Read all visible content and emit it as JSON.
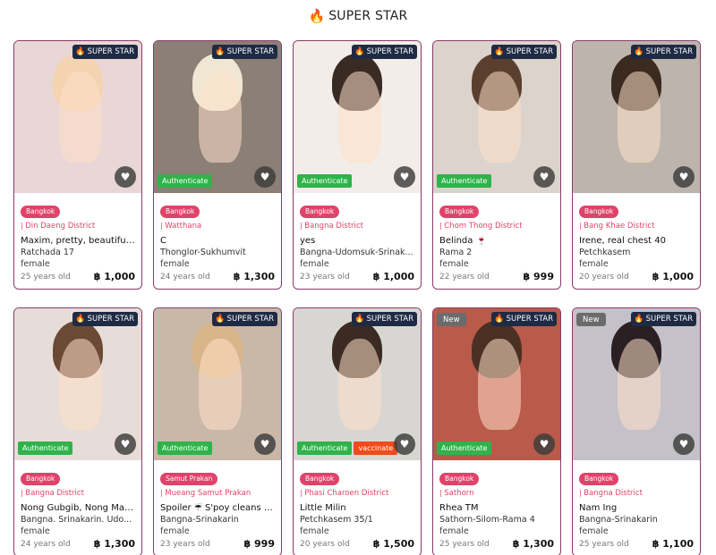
{
  "header": {
    "icon": "fire-icon",
    "title": "SUPER STAR"
  },
  "badge_label": "SUPER STAR",
  "authenticate_label": "Authenticate",
  "vaccinate_label": "vaccinate",
  "new_label": "New",
  "colors": {
    "accent": "#e0436a",
    "authenticate": "#2fb34a",
    "vaccinate": "#f24a1a",
    "badge": "#1f2a44",
    "border": "#8a3a6a"
  },
  "cards": [
    {
      "city": "Bangkok",
      "district": "Din Daeng District",
      "name": "Maxim, pretty, beautiful, ...",
      "location": "Ratchada 17",
      "gender": "female",
      "age": "25 years old",
      "price": "฿ 1,000",
      "authenticate": false,
      "vaccinate": false,
      "new": false,
      "bg": "#e9d6d6",
      "hair": "#f3d3b0"
    },
    {
      "city": "Bangkok",
      "district": "Watthana",
      "name": "C",
      "location": "Thonglor-Sukhumvit",
      "gender": "female",
      "age": "24 years old",
      "price": "฿ 1,300",
      "authenticate": true,
      "vaccinate": false,
      "new": false,
      "bg": "#8c7f76",
      "hair": "#efe6d4"
    },
    {
      "city": "Bangkok",
      "district": "Bangna District",
      "name": "yes",
      "location": "Bangna-Udomsuk-Srinak...",
      "gender": "female",
      "age": "23 years old",
      "price": "฿ 1,000",
      "authenticate": true,
      "vaccinate": false,
      "new": false,
      "bg": "#f2ede8",
      "hair": "#3a2a24"
    },
    {
      "city": "Bangkok",
      "district": "Chom Thong District",
      "name": "Belinda 🍷",
      "location": "Rama 2",
      "gender": "female",
      "age": "22 years old",
      "price": "฿ 999",
      "authenticate": true,
      "vaccinate": false,
      "new": false,
      "bg": "#dcd3cd",
      "hair": "#5a3f2e"
    },
    {
      "city": "Bangkok",
      "district": "Bang Khae District",
      "name": "Irene, real chest 40",
      "location": "Petchkasem",
      "gender": "female",
      "age": "20 years old",
      "price": "฿ 1,000",
      "authenticate": false,
      "vaccinate": false,
      "new": false,
      "bg": "#bdb5ad",
      "hair": "#3a2a20"
    },
    {
      "city": "Bangkok",
      "district": "Bangna District",
      "name": "Nong Gubgib, Nong Mai t...",
      "location": "Bangna. Srinakarin. Udo...",
      "gender": "female",
      "age": "24 years old",
      "price": "฿ 1,300",
      "authenticate": true,
      "vaccinate": false,
      "new": false,
      "bg": "#e7ddd8",
      "hair": "#6a4a35"
    },
    {
      "city": "Samut Prakan",
      "district": "Mueang Samut Prakan",
      "name": "Spoiler ☔ S'poy cleans th...",
      "location": "Bangna-Srinakarin",
      "gender": "female",
      "age": "23 years old",
      "price": "฿ 999",
      "authenticate": true,
      "vaccinate": false,
      "new": false,
      "bg": "#c9b8a8",
      "hair": "#d9b58a"
    },
    {
      "city": "Bangkok",
      "district": "Phasi Charoen District",
      "name": "Little Milin",
      "location": "Petchkasem 35/1",
      "gender": "female",
      "age": "20 years old",
      "price": "฿ 1,500",
      "authenticate": true,
      "vaccinate": true,
      "new": false,
      "bg": "#d8d6d2",
      "hair": "#3b2b22"
    },
    {
      "city": "Bangkok",
      "district": "Sathorn",
      "name": "Rhea TM",
      "location": "Sathorn-Silom-Rama 4",
      "gender": "female",
      "age": "25 years old",
      "price": "฿ 1,300",
      "authenticate": true,
      "vaccinate": false,
      "new": true,
      "bg": "#b95a4a",
      "hair": "#4a3022"
    },
    {
      "city": "Bangkok",
      "district": "Bangna District",
      "name": "Nam Ing",
      "location": "Bangna-Srinakarin",
      "gender": "female",
      "age": "25 years old",
      "price": "฿ 1,100",
      "authenticate": false,
      "vaccinate": false,
      "new": true,
      "bg": "#c4c2c8",
      "hair": "#2a2024"
    }
  ]
}
